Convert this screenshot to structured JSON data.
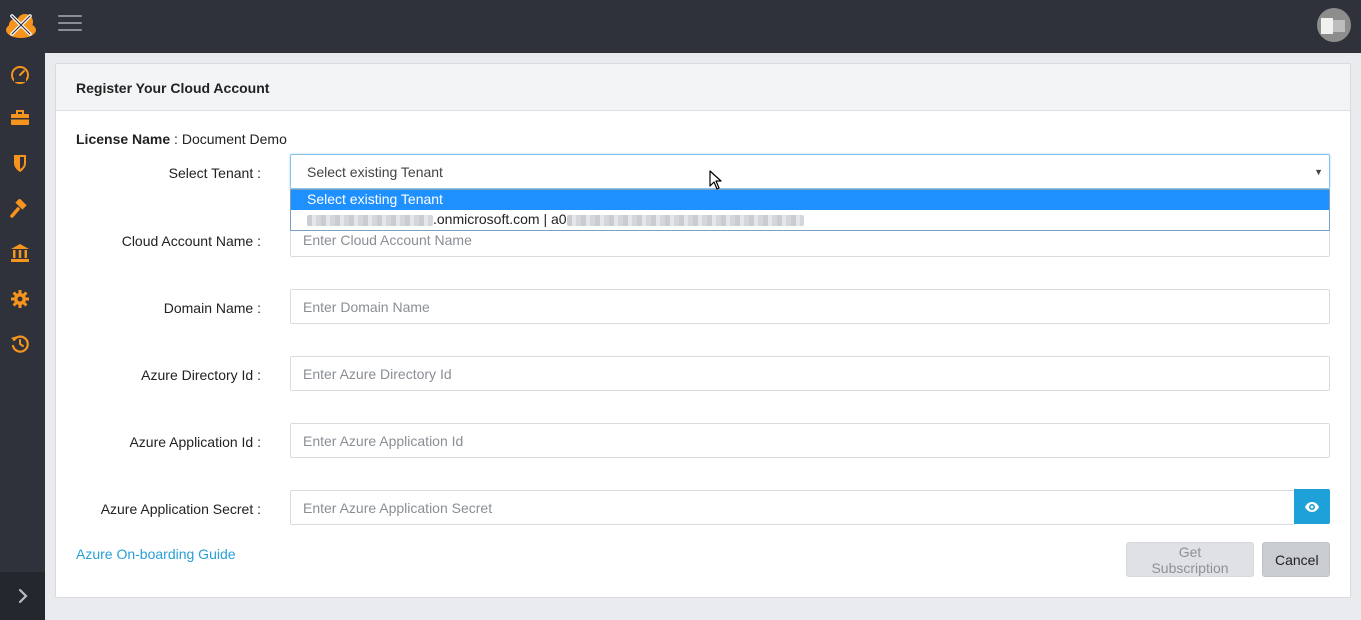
{
  "header": {
    "logo_icon": "tools-cloud-logo",
    "menu_icon": "hamburger-icon",
    "avatar_label": "user-avatar"
  },
  "sidebar": {
    "items": [
      {
        "icon": "speedometer-icon"
      },
      {
        "icon": "briefcase-icon"
      },
      {
        "icon": "shield-icon"
      },
      {
        "icon": "hammer-icon"
      },
      {
        "icon": "bank-icon"
      },
      {
        "icon": "gear-icon"
      },
      {
        "icon": "history-icon"
      }
    ],
    "expand_icon": "chevron-right-icon",
    "accent_color": "#f7941d"
  },
  "card": {
    "title": "Register Your Cloud Account"
  },
  "license": {
    "label": "License Name",
    "separator": " : ",
    "value": "Document Demo"
  },
  "form": {
    "tenant": {
      "label": "Select Tenant :",
      "selected": "Select existing Tenant",
      "options": [
        "Select existing Tenant",
        ".onmicrosoft.com | a0"
      ]
    },
    "cloud_account_name": {
      "label": "Cloud Account Name :",
      "placeholder": "Enter Cloud Account Name"
    },
    "domain_name": {
      "label": "Domain Name :",
      "placeholder": "Enter Domain Name"
    },
    "azure_directory_id": {
      "label": "Azure Directory Id :",
      "placeholder": "Enter Azure Directory Id"
    },
    "azure_application_id": {
      "label": "Azure Application Id :",
      "placeholder": "Enter Azure Application Id"
    },
    "azure_application_secret": {
      "label": "Azure Application Secret :",
      "placeholder": "Enter Azure Application Secret"
    }
  },
  "footer": {
    "guide_link": "Azure On-boarding Guide",
    "get_subscription": "Get Subscription",
    "cancel": "Cancel"
  },
  "colors": {
    "topbar": "#2f323a",
    "primary": "#1da1d8",
    "dropdown_selected": "#1e90ff",
    "link": "#2a9fd6"
  }
}
